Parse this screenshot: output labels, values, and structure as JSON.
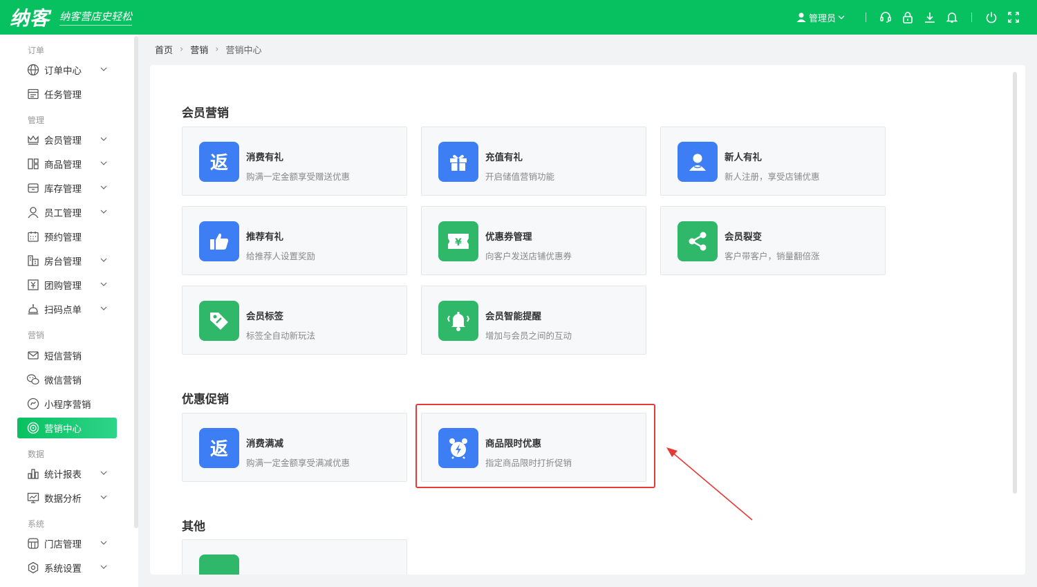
{
  "brand": {
    "logo": "纳客",
    "slogan": "纳客营店史轻松",
    "color": "#07c160"
  },
  "topbar": {
    "user_label": "管理员",
    "icons": [
      "headset-icon",
      "lock-icon",
      "download-icon",
      "bell-icon",
      "power-icon",
      "fullscreen-icon"
    ]
  },
  "sidebar": {
    "groups": [
      {
        "label": "订单",
        "items": [
          {
            "label": "订单中心",
            "icon": "globe-icon",
            "chevron": true
          },
          {
            "label": "任务管理",
            "icon": "task-icon",
            "chevron": false
          }
        ]
      },
      {
        "label": "管理",
        "items": [
          {
            "label": "会员管理",
            "icon": "crown-icon",
            "chevron": true
          },
          {
            "label": "商品管理",
            "icon": "goods-icon",
            "chevron": true
          },
          {
            "label": "库存管理",
            "icon": "box-icon",
            "chevron": true
          },
          {
            "label": "员工管理",
            "icon": "person-icon",
            "chevron": true
          },
          {
            "label": "预约管理",
            "icon": "calendar-icon",
            "chevron": false
          },
          {
            "label": "房台管理",
            "icon": "room-icon",
            "chevron": true
          },
          {
            "label": "团购管理",
            "icon": "groupbuy-icon",
            "chevron": true
          },
          {
            "label": "扫码点单",
            "icon": "scan-icon",
            "chevron": true
          }
        ]
      },
      {
        "label": "营销",
        "items": [
          {
            "label": "短信营销",
            "icon": "mail-icon",
            "chevron": false
          },
          {
            "label": "微信营销",
            "icon": "wechat-icon",
            "chevron": false
          },
          {
            "label": "小程序营销",
            "icon": "miniapp-icon",
            "chevron": false
          },
          {
            "label": "营销中心",
            "icon": "target-icon",
            "chevron": false,
            "active": true
          }
        ]
      },
      {
        "label": "数据",
        "items": [
          {
            "label": "统计报表",
            "icon": "bar-chart-icon",
            "chevron": true
          },
          {
            "label": "数据分析",
            "icon": "monitor-chart-icon",
            "chevron": true
          }
        ]
      },
      {
        "label": "系统",
        "items": [
          {
            "label": "门店管理",
            "icon": "store-icon",
            "chevron": true
          },
          {
            "label": "系统设置",
            "icon": "settings-icon",
            "chevron": true
          }
        ]
      }
    ]
  },
  "breadcrumb": [
    "首页",
    "营销",
    "营销中心"
  ],
  "sections": [
    {
      "title": "会员营销",
      "cards": [
        {
          "title": "消费有礼",
          "desc": "购满一定金额享受赠送优惠",
          "icon": "return-icon",
          "color": "#3d7ef5"
        },
        {
          "title": "充值有礼",
          "desc": "开启储值营销功能",
          "icon": "gift-icon",
          "color": "#3d7ef5"
        },
        {
          "title": "新人有礼",
          "desc": "新人注册，享受店铺优惠",
          "icon": "user-icon",
          "color": "#3d7ef5"
        },
        {
          "title": "推荐有礼",
          "desc": "给推荐人设置奖励",
          "icon": "thumbs-up-icon",
          "color": "#3d7ef5"
        },
        {
          "title": "优惠券管理",
          "desc": "向客户发送店铺优惠券",
          "icon": "coupon-icon",
          "color": "#2fb76a"
        },
        {
          "title": "会员裂变",
          "desc": "客户带客户，销量翻倍涨",
          "icon": "share-icon",
          "color": "#2fb76a"
        },
        {
          "title": "会员标签",
          "desc": "标签全自动新玩法",
          "icon": "tag-icon",
          "color": "#2fb76a"
        },
        {
          "title": "会员智能提醒",
          "desc": "增加与会员之间的互动",
          "icon": "ringing-bell-icon",
          "color": "#2fb76a"
        }
      ]
    },
    {
      "title": "优惠促销",
      "cards": [
        {
          "title": "消费满减",
          "desc": "购满一定金额享受满减优惠",
          "icon": "return-icon",
          "color": "#3d7ef5"
        },
        {
          "title": "商品限时优惠",
          "desc": "指定商品限时打折促销",
          "icon": "alarm-clock-icon",
          "color": "#3d7ef5"
        }
      ]
    },
    {
      "title": "其他",
      "cards": [
        {
          "title": "",
          "desc": "",
          "icon": "partial-icon",
          "color": "#2fb76a"
        }
      ]
    }
  ],
  "annotation_color": "#e53935"
}
